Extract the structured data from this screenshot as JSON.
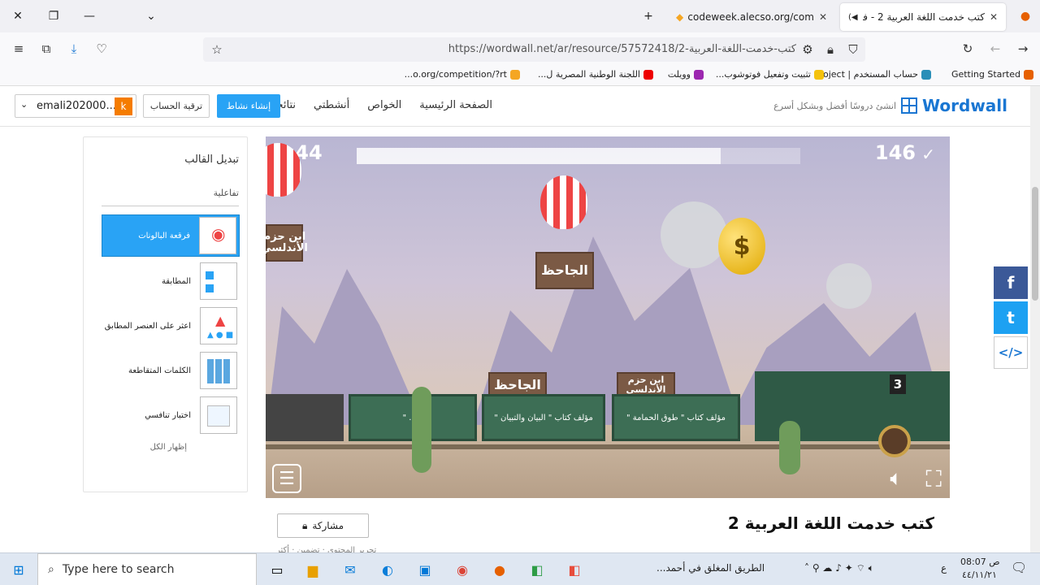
{
  "browser": {
    "tabs": [
      {
        "label": "كتب خدمت اللغة العربية 2 - فرقمة",
        "active": true
      },
      {
        "label": "arabcodeweek.alecso.org/com",
        "active": false
      }
    ],
    "new_tab": "+",
    "url": "https://wordwall.net/ar/resource/57572418/2-كتب-خدمت-اللغة-العربية",
    "bookmarks": [
      "Getting Started",
      "حساب المستخدم | oject...",
      "تثبيت وتفعيل فوتوشوب...",
      "وويلت",
      "اللجنة الوطنية المصرية ل...",
      "o.org/competition/?rt..."
    ]
  },
  "site": {
    "logo_text": "Wordwall",
    "tagline": "انشئ دروسًا أفضل وبشكل أسرع",
    "nav": [
      "الصفحة الرئيسية",
      "الخواص",
      "أنشطتي",
      "نتائجي"
    ],
    "create_label": "إنشاء نشاط",
    "upgrade_label": "ترقية الحساب",
    "account_initial": "k",
    "account_name": "emali202000..."
  },
  "sidepanel": {
    "title": "تبديل القالب",
    "subtitle": "تفاعلية",
    "templates": [
      {
        "name": "فرقعة البالونات",
        "selected": true
      },
      {
        "name": "المطابقة",
        "selected": false
      },
      {
        "name": "اعثر على العنصر المطابق",
        "selected": false
      },
      {
        "name": "الكلمات المتقاطعة",
        "selected": false
      },
      {
        "name": "اختبار تنافسي",
        "selected": false
      }
    ],
    "show_all": "إظهار الكل"
  },
  "game": {
    "timer": "0:44",
    "score": "146",
    "progress": 0.82,
    "train_number": "3",
    "balloons": [
      {
        "label": "ابن حزم الأندلسي"
      },
      {
        "label": "الجاحظ"
      }
    ],
    "wagons": [
      {
        "label": "\" ... \""
      },
      {
        "label": "مؤلف كتاب \" البيان والتبيان \""
      },
      {
        "label": "مؤلف كتاب \" طوق الحمامة \""
      }
    ],
    "crates": [
      {
        "label": "الجاحظ"
      },
      {
        "label": "ابن حزم الأندلسي"
      }
    ],
    "gold_symbol": "$"
  },
  "activity": {
    "title": "كتب خدمت اللغة العربية 2",
    "share_label": "مشاركة",
    "meta": "تحرير المحتوى  ·  تضمين  ·  أكثر"
  },
  "social": [
    "f",
    "t",
    "</>"
  ],
  "taskbar": {
    "search_placeholder": "Type here to search",
    "news": "الطريق المغلق في أحمد...",
    "time": "08:07 ص",
    "date": "٤٤/١١/٢١",
    "lang": "ع"
  },
  "colors": {
    "accent": "#29a3f5",
    "logo": "#1976d2",
    "facebook": "#3b5998",
    "twitter": "#1da1f2"
  }
}
